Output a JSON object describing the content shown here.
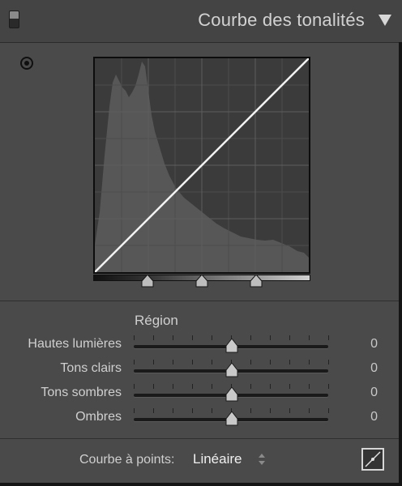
{
  "panel": {
    "title": "Courbe des tonalités",
    "collapse_icon": "triangle-down-icon"
  },
  "curve": {
    "mode_icon": "target-adjust-icon",
    "split_points_percent": [
      25,
      50,
      75
    ]
  },
  "region": {
    "label": "Région",
    "sliders": [
      {
        "label": "Hautes lumières",
        "value": "0"
      },
      {
        "label": "Tons clairs",
        "value": "0"
      },
      {
        "label": "Tons sombres",
        "value": "0"
      },
      {
        "label": "Ombres",
        "value": "0"
      }
    ]
  },
  "point_curve": {
    "label": "Courbe à points:",
    "value": "Linéaire",
    "edit_icon": "edit-point-curve-icon"
  }
}
